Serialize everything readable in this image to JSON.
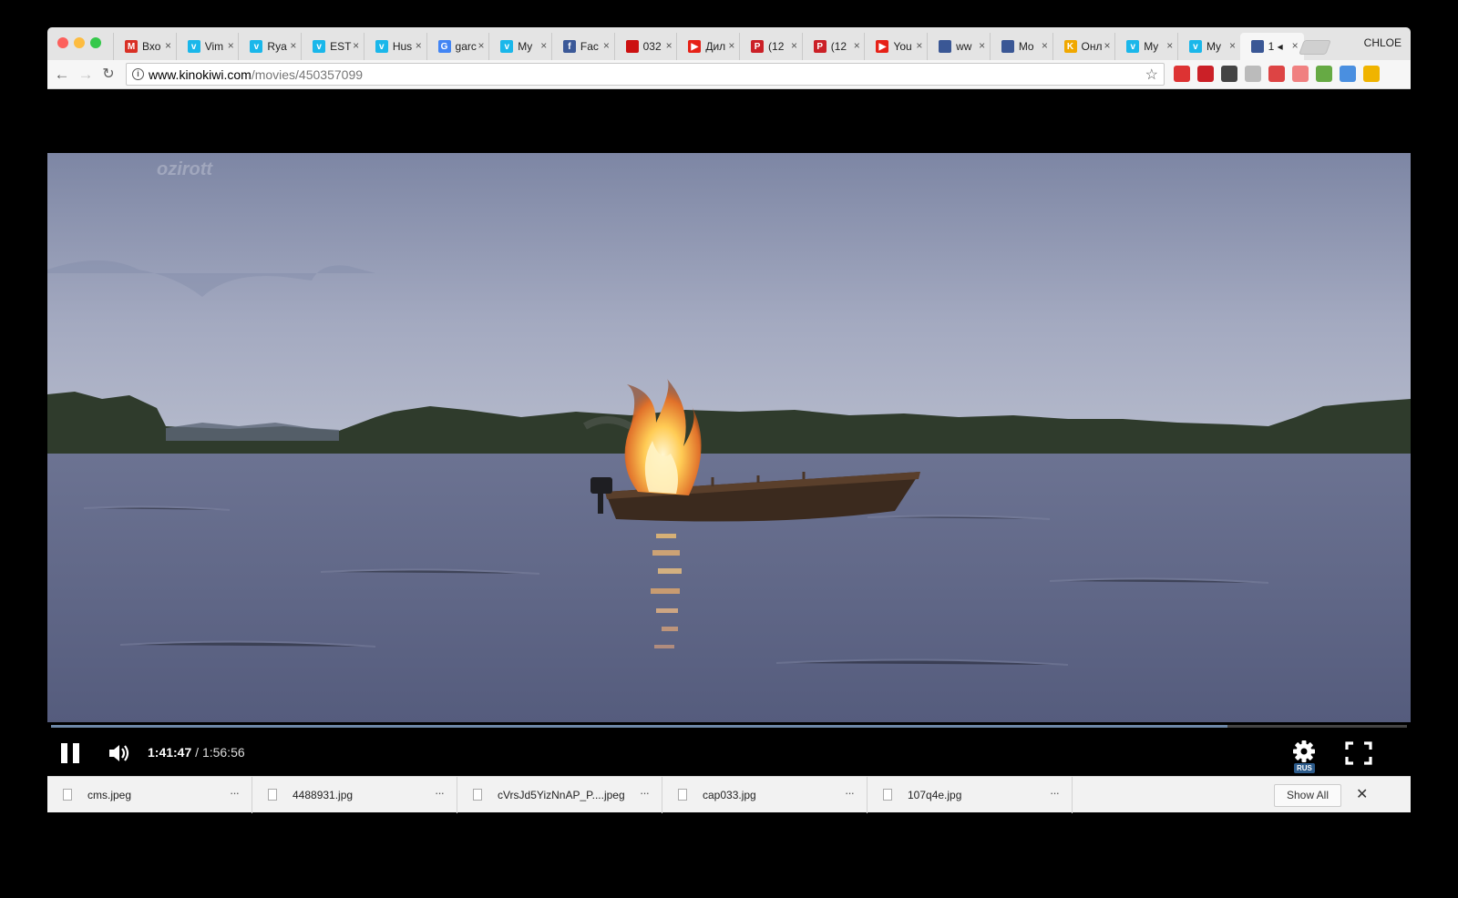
{
  "browser": {
    "profile_name": "CHLOE",
    "tabs": [
      {
        "title": "Вхо",
        "icon": "gmail-icon",
        "color": "#d93025",
        "glyph": "M"
      },
      {
        "title": "Vim",
        "icon": "vimeo-icon",
        "color": "#1ab7ea",
        "glyph": "v"
      },
      {
        "title": "Rya",
        "icon": "vimeo-icon",
        "color": "#1ab7ea",
        "glyph": "v"
      },
      {
        "title": "EST",
        "icon": "vimeo-icon",
        "color": "#1ab7ea",
        "glyph": "v"
      },
      {
        "title": "Hus",
        "icon": "vimeo-icon",
        "color": "#1ab7ea",
        "glyph": "v"
      },
      {
        "title": "garc",
        "icon": "google-icon",
        "color": "#4285f4",
        "glyph": "G"
      },
      {
        "title": "My",
        "icon": "vimeo-icon",
        "color": "#1ab7ea",
        "glyph": "v"
      },
      {
        "title": "Fac",
        "icon": "facebook-icon",
        "color": "#3b5998",
        "glyph": "f"
      },
      {
        "title": "032",
        "icon": "red-site-icon",
        "color": "#cc1010",
        "glyph": ""
      },
      {
        "title": "Дил",
        "icon": "youtube-icon",
        "color": "#e62117",
        "glyph": "▶"
      },
      {
        "title": "(12",
        "icon": "pinterest-icon",
        "color": "#cb2027",
        "glyph": "P"
      },
      {
        "title": "(12",
        "icon": "pinterest-icon",
        "color": "#cb2027",
        "glyph": "P"
      },
      {
        "title": "You",
        "icon": "youtube-icon",
        "color": "#e62117",
        "glyph": "▶"
      },
      {
        "title": "ww",
        "icon": "kinokiwi-icon",
        "color": "#3a5795",
        "glyph": ""
      },
      {
        "title": "Mo",
        "icon": "kinokiwi-icon",
        "color": "#3a5795",
        "glyph": ""
      },
      {
        "title": "Онл",
        "icon": "kinopoisk-icon",
        "color": "#f0a800",
        "glyph": "K"
      },
      {
        "title": "My",
        "icon": "vimeo-icon",
        "color": "#1ab7ea",
        "glyph": "v"
      },
      {
        "title": "My",
        "icon": "vimeo-icon",
        "color": "#1ab7ea",
        "glyph": "v"
      },
      {
        "title": "1 ◂",
        "icon": "kinokiwi-icon",
        "color": "#3a5795",
        "glyph": "",
        "active": true
      }
    ],
    "url_domain": "www.kinokiwi.com",
    "url_path": "/movies/450357099"
  },
  "extensions": [
    {
      "icon": "gmail-counter-icon",
      "color": "#d33"
    },
    {
      "icon": "pinterest-icon",
      "color": "#cb2027"
    },
    {
      "icon": "ghostery-icon",
      "color": "#444"
    },
    {
      "icon": "paw-icon",
      "color": "#bbb"
    },
    {
      "icon": "adblock-icon",
      "color": "#d44"
    },
    {
      "icon": "arrow-extension-icon",
      "color": "#f08080"
    },
    {
      "icon": "leaf-extension-icon",
      "color": "#6a4"
    },
    {
      "icon": "sync-extension-icon",
      "color": "#4a8fe0"
    },
    {
      "icon": "alert-extension-icon",
      "color": "#f0b400"
    }
  ],
  "player": {
    "current_time": "1:41:47",
    "separator": "/",
    "duration": "1:56:56",
    "progress_fraction": 0.8677,
    "subtitle_lang": "RUS"
  },
  "downloads": {
    "items": [
      {
        "filename": "cms.jpeg"
      },
      {
        "filename": "4488931.jpg"
      },
      {
        "filename": "cVrsJd5YizNnAP_P....jpeg"
      },
      {
        "filename": "cap033.jpg"
      },
      {
        "filename": "107q4e.jpg"
      }
    ],
    "more_label": "···",
    "show_all_label": "Show All",
    "close_label": "✕"
  }
}
